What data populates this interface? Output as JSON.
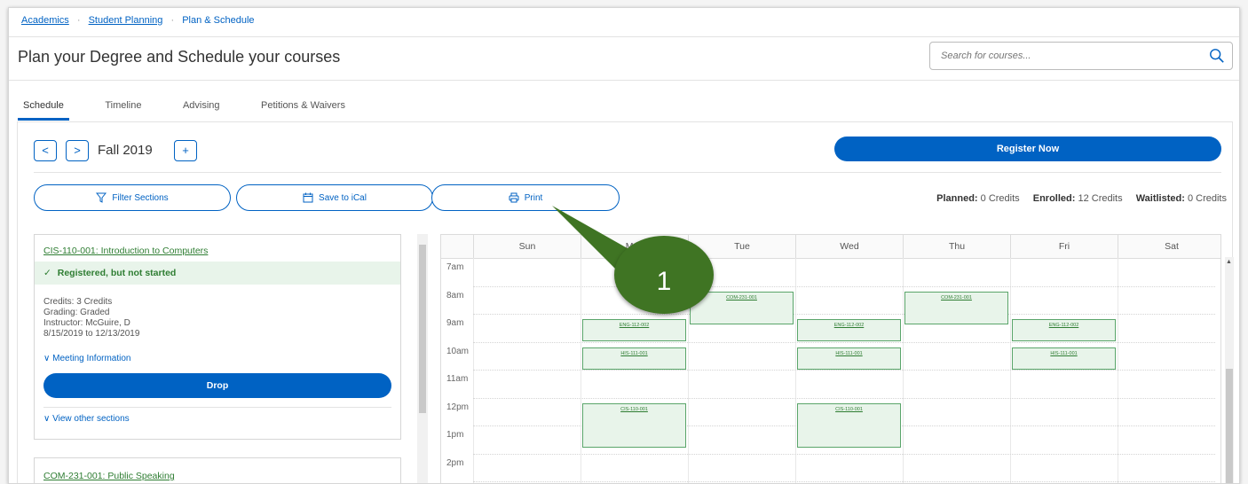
{
  "breadcrumb": {
    "items": [
      "Academics",
      "Student Planning",
      "Plan & Schedule"
    ]
  },
  "page": {
    "title": "Plan your Degree and Schedule your courses"
  },
  "search": {
    "placeholder": "Search for courses..."
  },
  "tabs": [
    "Schedule",
    "Timeline",
    "Advising",
    "Petitions & Waivers"
  ],
  "term": {
    "label": "Fall 2019",
    "prev": "<",
    "next": ">",
    "add": "+"
  },
  "actions": {
    "register": "Register Now",
    "filter": "Filter Sections",
    "ical": "Save to iCal",
    "print": "Print"
  },
  "credits": {
    "planned_label": "Planned:",
    "planned_value": "0 Credits",
    "enrolled_label": "Enrolled:",
    "enrolled_value": "12 Credits",
    "waitlisted_label": "Waitlisted:",
    "waitlisted_value": "0 Credits"
  },
  "course1": {
    "title": "CIS-110-001: Introduction to Computers",
    "status": "Registered, but not started",
    "credits": "Credits: 3 Credits",
    "grading": "Grading: Graded",
    "instructor": "Instructor: McGuire, D",
    "dates": "8/15/2019 to 12/13/2019",
    "meeting": "Meeting Information",
    "drop": "Drop",
    "other": "View other sections"
  },
  "course2": {
    "title": "COM-231-001: Public Speaking"
  },
  "calendar": {
    "days": [
      "Sun",
      "Mon",
      "Tue",
      "Wed",
      "Thu",
      "Fri",
      "Sat"
    ],
    "times": [
      "7am",
      "8am",
      "9am",
      "10am",
      "11am",
      "12pm",
      "1pm",
      "2pm"
    ],
    "events": [
      {
        "label": "COM-231-001",
        "day": 2,
        "start": 8,
        "end": 9.2
      },
      {
        "label": "COM-231-001",
        "day": 4,
        "start": 8,
        "end": 9.2
      },
      {
        "label": "ENG-112-002",
        "day": 1,
        "start": 9,
        "end": 9.8
      },
      {
        "label": "ENG-112-002",
        "day": 3,
        "start": 9,
        "end": 9.8
      },
      {
        "label": "ENG-112-002",
        "day": 5,
        "start": 9,
        "end": 9.8
      },
      {
        "label": "HIS-111-001",
        "day": 1,
        "start": 10,
        "end": 10.8
      },
      {
        "label": "HIS-111-001",
        "day": 3,
        "start": 10,
        "end": 10.8
      },
      {
        "label": "HIS-111-001",
        "day": 5,
        "start": 10,
        "end": 10.8
      },
      {
        "label": "CIS-110-001",
        "day": 1,
        "start": 12,
        "end": 13.6
      },
      {
        "label": "CIS-110-001",
        "day": 3,
        "start": 12,
        "end": 13.6
      }
    ]
  },
  "annotation": {
    "number": "1"
  }
}
